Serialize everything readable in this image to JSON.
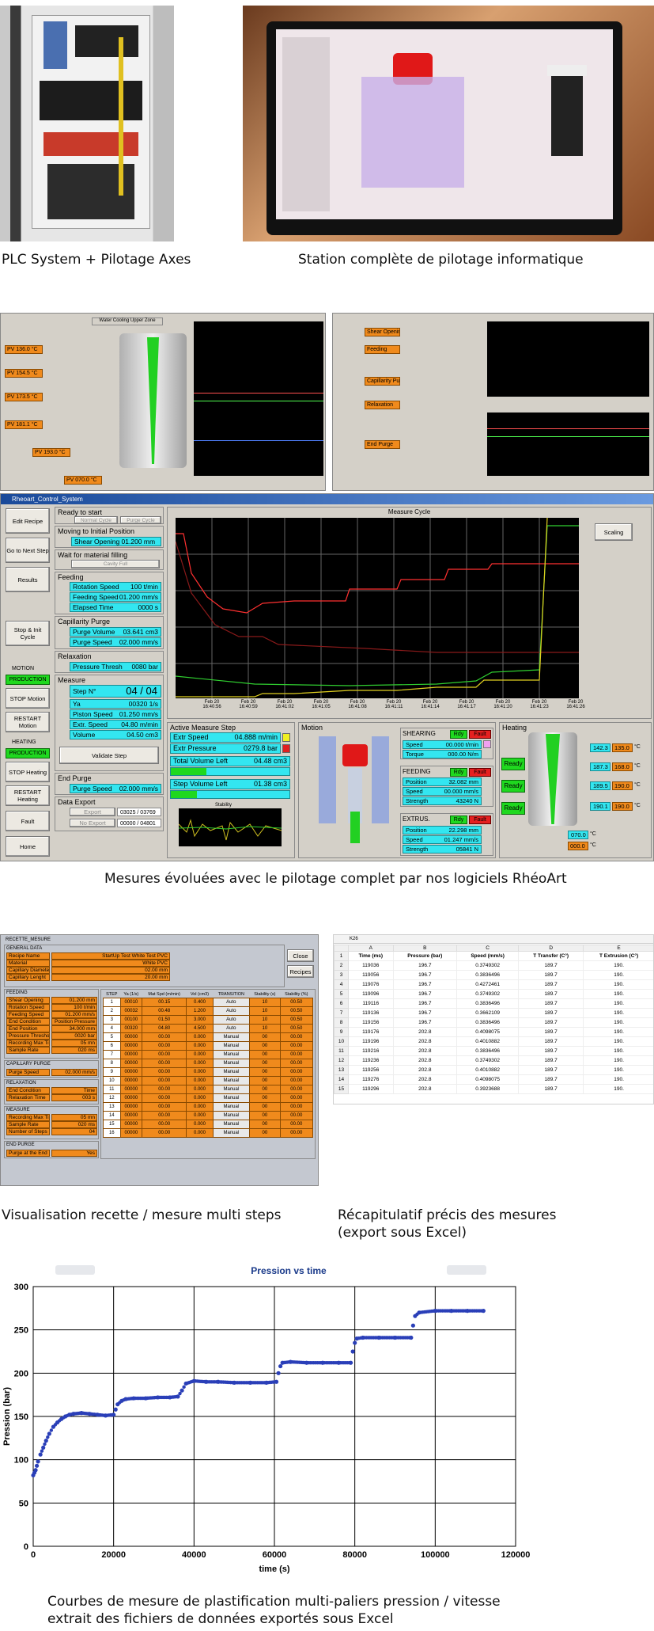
{
  "captions": {
    "plc": "PLC System + Pilotage Axes",
    "station": "Station complète de pilotage informatique",
    "mesures": "Mesures évoluées avec le pilotage complet par nos logiciels RhéoArt",
    "recette": "Visualisation recette / mesure multi steps",
    "excel_line1": "Récapitulatif précis des mesures",
    "excel_line2": "(export sous Excel)",
    "courbes_line1": "Courbes de mesure de plastification multi-paliers pression / vitesse",
    "courbes_line2": "extrait des fichiers de données exportés sous Excel"
  },
  "control_window": {
    "title": "Rheoart_Control_System",
    "left_buttons": [
      "Edit Recipe",
      "Go to Next Step",
      "Results",
      "Stop & Init Cycle"
    ],
    "motion_label": "MOTION",
    "production": "PRODUCTION",
    "stop_motion": "STOP Motion",
    "restart_motion": "RESTART Motion",
    "heating_label": "HEATING",
    "stop_heating": "STOP Heating",
    "restart_heating": "RESTART Heating",
    "fault": "Fault",
    "home": "Home",
    "ready": "Ready to start",
    "normal_cycle": "Normal Cycle",
    "purge_cycle": "Purge Cycle",
    "moving": "Moving to Initial Position",
    "shear_opening": "Shear Opening 01.200 mm",
    "wait": "Wait for material filling",
    "cavity_full": "Cavity Full",
    "feeding": "Feeding",
    "rotation_speed": "Rotation Speed",
    "rotation_speed_val": "100 t/min",
    "feeding_speed": "Feeding Speed",
    "feeding_speed_val": "01.200 mm/s",
    "elapsed": "Elapsed Time",
    "elapsed_val": "0000 s",
    "cap_purge": "Capillarity Purge",
    "purge_volume": "Purge Volume",
    "purge_volume_val": "03.641 cm3",
    "purge_speed": "Purge Speed",
    "purge_speed_val": "02.000 mm/s",
    "relaxation": "Relaxation",
    "pressure_thresh": "Pressure Thresh",
    "pressure_thresh_val": "0080 bar",
    "measure": "Measure",
    "step_no": "Step N°",
    "step_val": "04 / 04",
    "ya": "Ya",
    "ya_val": "00320 1/s",
    "piston_speed": "Piston Speed",
    "piston_speed_val": "01.250 mm/s",
    "extr_speed": "Extr. Speed",
    "extr_speed_val": "04.80 m/min",
    "volume": "Volume",
    "volume_val": "04.50 cm3",
    "validate": "Validate Step",
    "end_purge": "End Purge",
    "end_purge_speed": "Purge Speed",
    "end_purge_speed_val": "02.000 mm/s",
    "data_export": "Data Export",
    "export": "Export",
    "no_export": "No Export",
    "export_count1": "03025 / 03769",
    "export_count2": "00000 / 04801",
    "measure_cycle": "Measure Cycle",
    "scaling": "Scaling",
    "time_ticks": [
      "Feb 20 16:40:56",
      "Feb 20 16:40:59",
      "Feb 20 16:41:02",
      "Feb 20 16:41:05",
      "Feb 20 16:41:08",
      "Feb 20 16:41:11",
      "Feb 20 16:41:14",
      "Feb 20 16:41:17",
      "Feb 20 16:41:20",
      "Feb 20 16:41:23",
      "Feb 20 16:41:26",
      "Feb"
    ],
    "active_step": "Active Measure Step",
    "extr_speed_a": "Extr Speed",
    "extr_speed_a_val": "04.888 m/min",
    "extr_pressure": "Extr Pressure",
    "extr_pressure_val": "0279.8 bar",
    "total_vol_left": "Total Volume Left",
    "total_vol_left_val": "04.48 cm3",
    "step_vol_left": "Step Volume Left",
    "step_vol_left_val": "01.38 cm3",
    "stability": "Stability",
    "motion": "Motion",
    "shearing": "SHEARING",
    "rdy": "Rdy",
    "fault_small": "Fault",
    "shear_speed": "Speed",
    "shear_speed_val": "00.000 t/min",
    "torque": "Torque",
    "torque_val": "000.00 N/m",
    "feeding_box": "FEEDING",
    "feed_position": "Position",
    "feed_position_val": "32.082 mm",
    "feed_speed": "Speed",
    "feed_speed_val": "00.000 mm/s",
    "feed_strength": "Strength",
    "feed_strength_val": "43240 N",
    "extrus": "EXTRUS.",
    "ext_position": "Position",
    "ext_position_val": "22.298 mm",
    "ext_speed": "Speed",
    "ext_speed_val": "01.247 mm/s",
    "ext_strength": "Strength",
    "ext_strength_val": "05841 N",
    "heating": "Heating",
    "ready_btn": "Ready",
    "heat_rows": [
      {
        "a": "142.3",
        "b": "135.0"
      },
      {
        "a": "187.3",
        "b": "168.0"
      },
      {
        "a": "189.5",
        "b": "190.0"
      },
      {
        "a": "190.1",
        "b": "190.0"
      }
    ],
    "bottom_temps": {
      "a": "070.0",
      "b": "000.0"
    },
    "deg": "°C"
  },
  "recipe_window": {
    "title": "RECETTE_MESURE",
    "general": "GENERAL DATA",
    "close": "Close",
    "recipes": "Recipes",
    "general_rows": [
      [
        "Recipe Name",
        "StartUp Test White Test PVC"
      ],
      [
        "Material",
        "White PVC"
      ],
      [
        "Capillary Diameter",
        "02.00 mm"
      ],
      [
        "Capillary Lenght",
        "20.00 mm"
      ]
    ],
    "feeding": "FEEDING",
    "feeding_rows": [
      [
        "Shear Opening",
        "01.200 mm"
      ],
      [
        "Rotation Speed",
        "100 t/min"
      ],
      [
        "Feeding Speed",
        "01.200 mm/s"
      ],
      [
        "End Condition",
        "Position Pressure"
      ],
      [
        "End Position",
        "34.000 mm"
      ],
      [
        "Pressure Threshold",
        "0020 bar"
      ],
      [
        "Recording Max Time",
        "05 mn"
      ],
      [
        "Sample Rate",
        "020 ms"
      ]
    ],
    "capillary": "CAPILLARY PURGE",
    "cap_rows": [
      [
        "Purge Speed",
        "02.000 mm/s"
      ]
    ],
    "relaxation": "RELAXATION",
    "relax_rows": [
      [
        "End Condition",
        "Time"
      ],
      [
        "Relaxation Time",
        "003 s"
      ]
    ],
    "measure": "MEASURE",
    "measure_rows": [
      [
        "Recording Max Time",
        "05 mn"
      ],
      [
        "Sample Rate",
        "020 ms"
      ],
      [
        "Number of Steps",
        "04"
      ]
    ],
    "end_purge": "END PURGE",
    "end_rows": [
      [
        "Purge at the End",
        "Yes"
      ]
    ],
    "step_headers": [
      "STEP",
      "Ya (1/s)",
      "Mat Spd (m/min)",
      "Vol (cm3)",
      "TRANSITION",
      "Stability (s)",
      "Stability (%)"
    ],
    "steps": [
      [
        "1",
        "00010",
        "00.15",
        "0.400",
        "Auto",
        "10",
        "00.50"
      ],
      [
        "2",
        "00032",
        "00.48",
        "1.200",
        "Auto",
        "10",
        "00.50"
      ],
      [
        "3",
        "00100",
        "01.50",
        "3.000",
        "Auto",
        "10",
        "00.50"
      ],
      [
        "4",
        "00320",
        "04.80",
        "4.500",
        "Auto",
        "10",
        "00.50"
      ],
      [
        "5",
        "00000",
        "00.00",
        "0.000",
        "Manual",
        "00",
        "00.00"
      ],
      [
        "6",
        "00000",
        "00.00",
        "0.000",
        "Manual",
        "00",
        "00.00"
      ],
      [
        "7",
        "00000",
        "00.00",
        "0.000",
        "Manual",
        "00",
        "00.00"
      ],
      [
        "8",
        "00000",
        "00.00",
        "0.000",
        "Manual",
        "00",
        "00.00"
      ],
      [
        "9",
        "00000",
        "00.00",
        "0.000",
        "Manual",
        "00",
        "00.00"
      ],
      [
        "10",
        "00000",
        "00.00",
        "0.000",
        "Manual",
        "00",
        "00.00"
      ],
      [
        "11",
        "00000",
        "00.00",
        "0.000",
        "Manual",
        "00",
        "00.00"
      ],
      [
        "12",
        "00000",
        "00.00",
        "0.000",
        "Manual",
        "00",
        "00.00"
      ],
      [
        "13",
        "00000",
        "00.00",
        "0.000",
        "Manual",
        "00",
        "00.00"
      ],
      [
        "14",
        "00000",
        "00.00",
        "0.000",
        "Manual",
        "00",
        "00.00"
      ],
      [
        "15",
        "00000",
        "00.00",
        "0.000",
        "Manual",
        "00",
        "00.00"
      ],
      [
        "16",
        "00000",
        "00.00",
        "0.000",
        "Manual",
        "00",
        "00.00"
      ]
    ]
  },
  "excel": {
    "namebox": "K26",
    "col_letters": [
      "A",
      "B",
      "C",
      "D",
      "E"
    ],
    "headers": [
      "Time (ms)",
      "Pressure (bar)",
      "Speed (mm/s)",
      "T Transfer (C°)",
      "T Extrusion (C°)"
    ],
    "rows": [
      [
        "119036",
        "196.7",
        "0.3749302",
        "189.7",
        "190."
      ],
      [
        "119056",
        "196.7",
        "0.3836496",
        "189.7",
        "190."
      ],
      [
        "119076",
        "196.7",
        "0.4272461",
        "189.7",
        "190."
      ],
      [
        "119096",
        "196.7",
        "0.3749302",
        "189.7",
        "190."
      ],
      [
        "119116",
        "196.7",
        "0.3836496",
        "189.7",
        "190."
      ],
      [
        "119136",
        "196.7",
        "0.3662109",
        "189.7",
        "190."
      ],
      [
        "119156",
        "196.7",
        "0.3836496",
        "189.7",
        "190."
      ],
      [
        "119176",
        "202.8",
        "0.4098075",
        "189.7",
        "190."
      ],
      [
        "119196",
        "202.8",
        "0.4010882",
        "189.7",
        "190."
      ],
      [
        "119216",
        "202.8",
        "0.3836496",
        "189.7",
        "190."
      ],
      [
        "119236",
        "202.8",
        "0.3749302",
        "189.7",
        "190."
      ],
      [
        "119256",
        "202.8",
        "0.4010882",
        "189.7",
        "190."
      ],
      [
        "119276",
        "202.8",
        "0.4098075",
        "189.7",
        "190."
      ],
      [
        "119296",
        "202.8",
        "0.3923688",
        "189.7",
        "190."
      ]
    ]
  },
  "chart_data": {
    "type": "scatter",
    "title": "Pression vs time",
    "xlabel": "time (s)",
    "ylabel": "Pression (bar)",
    "xlim": [
      0,
      120000
    ],
    "ylim": [
      0,
      300
    ],
    "xticks": [
      0,
      20000,
      40000,
      60000,
      80000,
      100000,
      120000
    ],
    "yticks": [
      0,
      50,
      100,
      150,
      200,
      250,
      300
    ],
    "grid": true,
    "x": [
      0,
      300,
      600,
      900,
      1200,
      1800,
      2500,
      3200,
      4000,
      5000,
      6000,
      7000,
      8000,
      9000,
      10000,
      12000,
      14000,
      16000,
      18000,
      20000,
      20500,
      21000,
      22000,
      23000,
      25000,
      28000,
      31000,
      34000,
      36000,
      37000,
      38000,
      40000,
      43000,
      46000,
      50000,
      54000,
      58000,
      60500,
      61000,
      61500,
      62000,
      64000,
      68000,
      72000,
      76000,
      79000,
      79500,
      80000,
      80500,
      82000,
      86000,
      90000,
      94000,
      94500,
      95000,
      96000,
      100000,
      104000,
      108000,
      112000
    ],
    "y": [
      82,
      85,
      88,
      93,
      98,
      106,
      114,
      122,
      130,
      138,
      143,
      147,
      150,
      152,
      153,
      154,
      153,
      152,
      151,
      152,
      158,
      164,
      168,
      170,
      171,
      171,
      172,
      172,
      173,
      180,
      188,
      191,
      190,
      190,
      189,
      189,
      189,
      190,
      200,
      208,
      212,
      213,
      212,
      212,
      212,
      212,
      225,
      235,
      240,
      241,
      241,
      241,
      241,
      255,
      266,
      270,
      272,
      272,
      272,
      272
    ]
  }
}
